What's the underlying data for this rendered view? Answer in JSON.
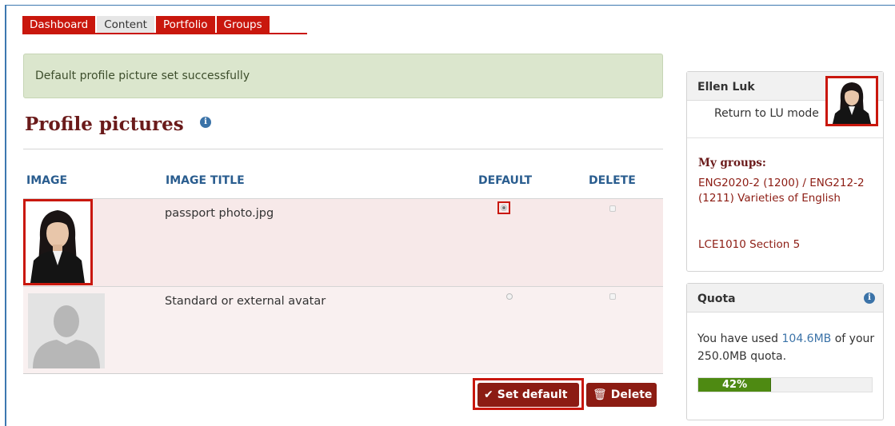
{
  "nav": {
    "tabs": [
      {
        "label": "Dashboard",
        "active": false
      },
      {
        "label": "Content",
        "active": true
      },
      {
        "label": "Portfolio",
        "active": false
      },
      {
        "label": "Groups",
        "active": false
      }
    ]
  },
  "message": {
    "text": "Default profile picture set successfully"
  },
  "page": {
    "title": "Profile pictures",
    "info_icon": "i"
  },
  "table": {
    "headers": {
      "image": "IMAGE",
      "title": "IMAGE TITLE",
      "default": "DEFAULT",
      "delete": "DELETE"
    },
    "rows": [
      {
        "title": "passport photo.jpg",
        "default": true,
        "delete": false
      },
      {
        "title": "Standard or external avatar",
        "default": false,
        "delete": false
      }
    ]
  },
  "actions": {
    "set_default": "Set default",
    "set_default_icon": "✔",
    "delete": "Delete",
    "delete_icon": "🗑"
  },
  "sidebar": {
    "user_name": "Ellen Luk",
    "return_link": "Return to LU mode",
    "groups_title": "My groups:",
    "groups": [
      "ENG2020-2 (1200) / ENG212-2 (1211) Varieties of English",
      "LCE1010 Section 5"
    ],
    "quota": {
      "title": "Quota",
      "text_prefix": "You have used ",
      "used": "104.6MB",
      "text_mid": " of your ",
      "total": "250.0MB",
      "text_suffix": " quota.",
      "percent_label": "42%",
      "percent": 42
    }
  },
  "colors": {
    "tab_red": "#c9170d",
    "button_red": "#8c1c13",
    "heading": "#6a1a1a",
    "link_blue": "#3b73a8",
    "quota_green": "#4e8a12",
    "success_bg": "#dbe6cd"
  }
}
